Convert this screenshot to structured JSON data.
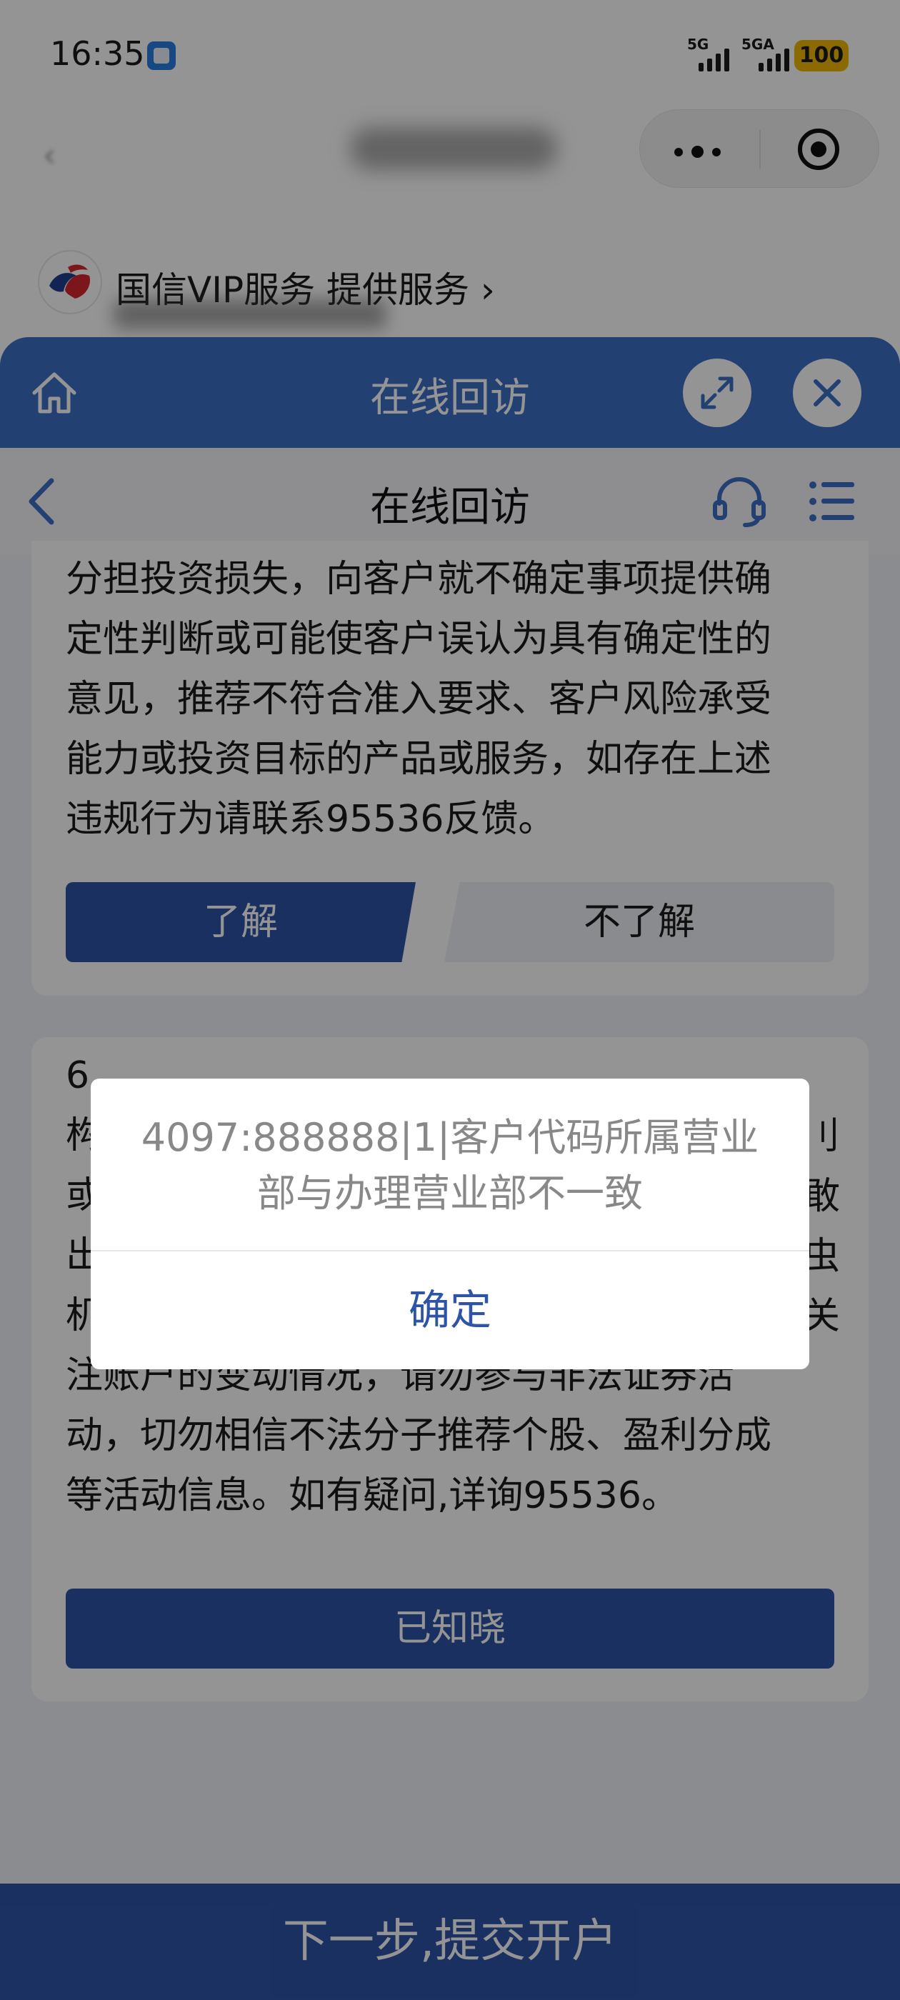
{
  "status_bar": {
    "time": "16:35",
    "signal1_label": "5G",
    "signal2_label": "5GA",
    "battery": "100"
  },
  "provider": {
    "text": "国信VIP服务 提供服务 ›"
  },
  "sheet": {
    "title": "在线回访"
  },
  "inner_header": {
    "title": "在线回访"
  },
  "card1": {
    "text_lines": [
      "分担投资损失，向客户就不确定事项提供确",
      "定性判断或可能使客户误认为具有确定性的",
      "意见，推荐不符合准入要求、客户风险承受",
      "能力或投资目标的产品或服务，如存在上述",
      "违规行为请联系95536反馈。"
    ],
    "know_label": "了解",
    "unknow_label": "不了解"
  },
  "card2": {
    "text_lines": [
      "6",
      "构",
      "或",
      "出",
      "机",
      "注账户的变动情况，请勿参与非法证券活",
      "动，切勿相信不法分子推荐个股、盈利分成",
      "等活动信息。如有疑问,详询95536。"
    ],
    "right_fragments": [
      "刂",
      "敢",
      "虫",
      "关"
    ],
    "ack_label": "已知晓"
  },
  "footer": {
    "next_label": "下一步,提交开户"
  },
  "dialog": {
    "message_line1": "4097:888888|1|客户代码所属营业",
    "message_line2": "部与办理营业部不一致",
    "ok_label": "确定"
  },
  "colors": {
    "brand_blue": "#3d6fc7",
    "primary_button": "#2e54a8",
    "battery": "#f2b705"
  }
}
